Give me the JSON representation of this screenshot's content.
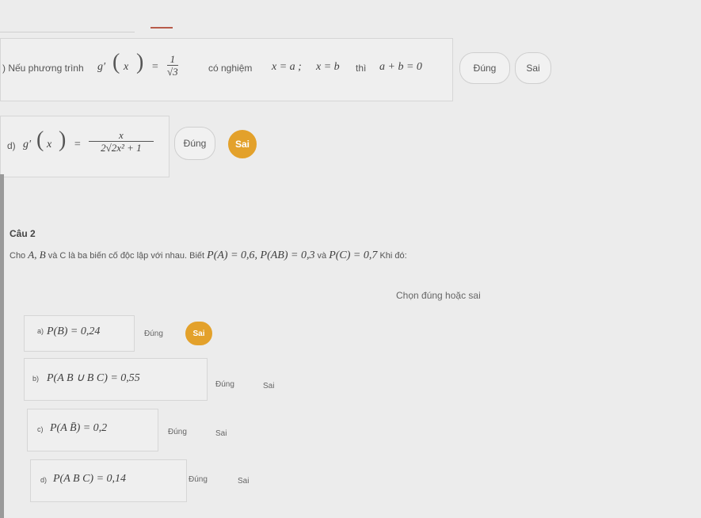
{
  "prev": {
    "c_label": ") Nếu phương trình",
    "c_expr_fn": "g′",
    "c_expr_var": "x",
    "c_expr_rhs_num": "1",
    "c_expr_rhs_den": "√3",
    "c_text_mid": "có nghiệm",
    "c_cond_1": "x = a ;",
    "c_cond_2": "x = b",
    "c_text_then": "thì",
    "c_cond_3": "a + b = 0",
    "c_true": "Đúng",
    "c_false": "Sai",
    "d_label": "d)",
    "d_expr_fn": "g′",
    "d_expr_var": "x",
    "d_num": "x",
    "d_den_pre": "2",
    "d_den_rad": "2x² + 1",
    "d_true": "Đúng",
    "d_false": "Sai"
  },
  "question": {
    "title": "Câu 2",
    "stem_a": "Cho",
    "stem_vars": "A, B",
    "stem_b": "và C là ba biến cố độc lập với nhau. Biết",
    "stem_p1": "P(A) = 0,6, P(AB) = 0,3",
    "stem_and": "và",
    "stem_p2": "P(C) = 0,7",
    "stem_end": "Khi đó:",
    "instruction": "Chọn đúng hoặc sai"
  },
  "statements": [
    {
      "label": "a)",
      "expr": "P(B) = 0,24",
      "true_label": "Đúng",
      "false_label": "Sai",
      "selected": "false"
    },
    {
      "label": "b)",
      "expr": "P(A B ∪ B C) = 0,55",
      "true_label": "Đúng",
      "false_label": "Sai",
      "selected": "none"
    },
    {
      "label": "c)",
      "expr": "P(A B̄) = 0,2",
      "true_label": "Đúng",
      "false_label": "Sai",
      "selected": "none"
    },
    {
      "label": "d)",
      "expr": "P(A B C) = 0,14",
      "true_label": "Đúng",
      "false_label": "Sai",
      "selected": "none"
    }
  ],
  "colors": {
    "accent": "#e3a12b",
    "background": "#ececec"
  }
}
